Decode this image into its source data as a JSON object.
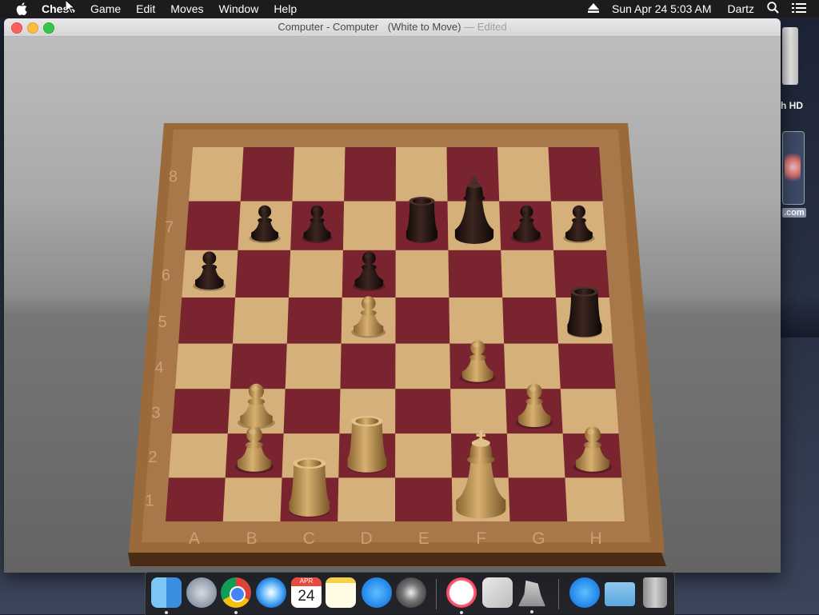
{
  "menubar": {
    "app_name": "Chess",
    "menus": [
      "Game",
      "Edit",
      "Moves",
      "Window",
      "Help"
    ],
    "clock": "Sun Apr 24  5:03 AM",
    "user": "Dartz",
    "icons": [
      "apple-icon",
      "eject-icon",
      "search-icon",
      "list-icon"
    ]
  },
  "window": {
    "title": "Computer - Computer",
    "status": "(White to Move)",
    "edited": "— Edited"
  },
  "board": {
    "files": [
      "A",
      "B",
      "C",
      "D",
      "E",
      "F",
      "G",
      "H"
    ],
    "ranks": [
      "8",
      "7",
      "6",
      "5",
      "4",
      "3",
      "2",
      "1"
    ],
    "colors": {
      "light": "#d6b07a",
      "dark": "#7a2430",
      "frame": "#9a6a3a",
      "black_piece": "#2a1a16",
      "white_piece": "#c49a5a"
    },
    "pieces": [
      {
        "color": "black",
        "type": "rook",
        "square": "e7"
      },
      {
        "color": "black",
        "type": "king",
        "square": "f7"
      },
      {
        "color": "black",
        "type": "pawn",
        "square": "b7"
      },
      {
        "color": "black",
        "type": "pawn",
        "square": "c7"
      },
      {
        "color": "black",
        "type": "pawn",
        "square": "g7"
      },
      {
        "color": "black",
        "type": "pawn",
        "square": "h7"
      },
      {
        "color": "black",
        "type": "pawn",
        "square": "a6"
      },
      {
        "color": "black",
        "type": "pawn",
        "square": "d6"
      },
      {
        "color": "black",
        "type": "rook",
        "square": "h5"
      },
      {
        "color": "white",
        "type": "pawn",
        "square": "d5"
      },
      {
        "color": "white",
        "type": "pawn",
        "square": "f4"
      },
      {
        "color": "white",
        "type": "pawn",
        "square": "b3"
      },
      {
        "color": "white",
        "type": "pawn",
        "square": "g3"
      },
      {
        "color": "white",
        "type": "pawn",
        "square": "b2"
      },
      {
        "color": "white",
        "type": "rook",
        "square": "d2"
      },
      {
        "color": "white",
        "type": "pawn",
        "square": "h2"
      },
      {
        "color": "white",
        "type": "rook",
        "square": "c1"
      },
      {
        "color": "white",
        "type": "king",
        "square": "f1"
      }
    ]
  },
  "desktop": {
    "hd_label": "h HD",
    "com_label": ".com"
  },
  "dock": {
    "items": [
      {
        "name": "finder",
        "icon": "finder-icon",
        "running": true
      },
      {
        "name": "launchpad",
        "icon": "rocket-icon",
        "running": false
      },
      {
        "name": "chrome",
        "icon": "chrome-icon",
        "running": true
      },
      {
        "name": "safari",
        "icon": "compass-icon",
        "running": false
      },
      {
        "name": "calendar",
        "icon": "calendar-icon",
        "running": false,
        "month": "APR",
        "day": "24"
      },
      {
        "name": "notes",
        "icon": "notes-icon",
        "running": false
      },
      {
        "name": "app-store",
        "icon": "app-store-icon",
        "running": false
      },
      {
        "name": "system-preferences",
        "icon": "gear-icon",
        "running": false
      },
      {
        "name": "itunes",
        "icon": "music-note-icon",
        "running": true
      },
      {
        "name": "preview",
        "icon": "preview-icon",
        "running": false
      },
      {
        "name": "chess",
        "icon": "chess-knight-icon",
        "running": true
      },
      {
        "name": "app-store-downloads",
        "icon": "app-store-icon",
        "running": false
      },
      {
        "name": "downloads-folder",
        "icon": "folder-icon",
        "running": false
      },
      {
        "name": "trash",
        "icon": "trash-icon",
        "running": false
      }
    ]
  }
}
